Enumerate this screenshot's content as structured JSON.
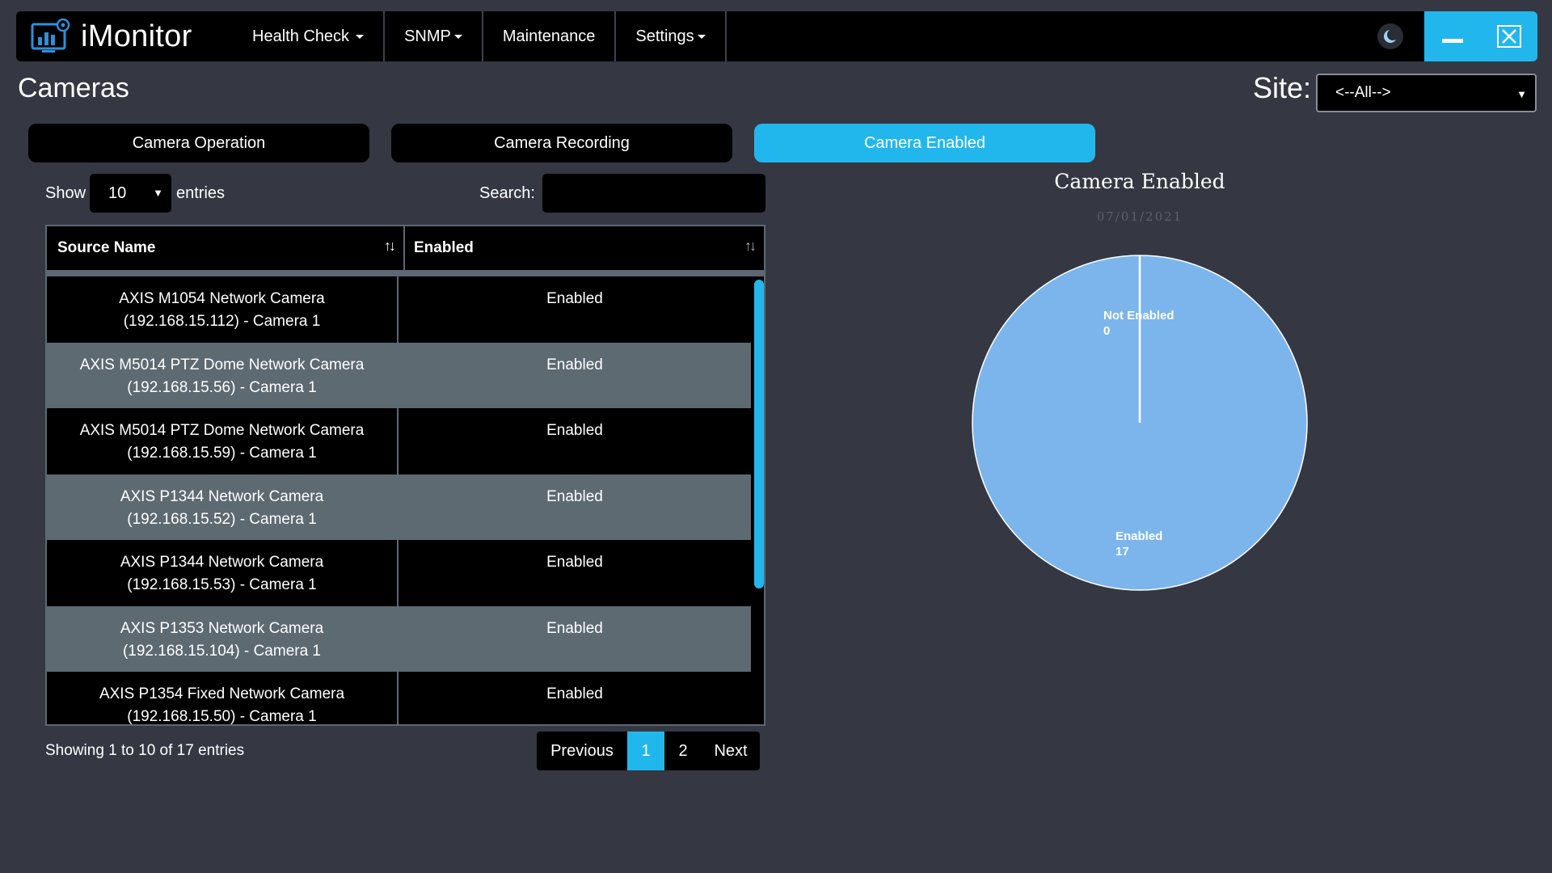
{
  "app": {
    "name": "iMonitor"
  },
  "nav": {
    "items": [
      {
        "label": "Health Check",
        "dropdown": true
      },
      {
        "label": "SNMP",
        "dropdown": true
      },
      {
        "label": "Maintenance",
        "dropdown": false
      },
      {
        "label": "Settings",
        "dropdown": true
      }
    ]
  },
  "page": {
    "title": "Cameras"
  },
  "site": {
    "label": "Site:",
    "value": "<--All-->"
  },
  "tabs": [
    {
      "label": "Camera Operation",
      "active": false
    },
    {
      "label": "Camera Recording",
      "active": false
    },
    {
      "label": "Camera Enabled",
      "active": true
    }
  ],
  "table_controls": {
    "show_label": "Show",
    "entries_value": "10",
    "entries_label": "entries",
    "search_label": "Search:",
    "search_value": ""
  },
  "table": {
    "columns": [
      "Source Name",
      "Enabled"
    ],
    "rows": [
      {
        "name_line1": "AXIS M1054 Network Camera",
        "name_line2": "(192.168.15.112) - Camera 1",
        "enabled": "Enabled"
      },
      {
        "name_line1": "AXIS M5014 PTZ Dome Network Camera",
        "name_line2": "(192.168.15.56) - Camera 1",
        "enabled": "Enabled"
      },
      {
        "name_line1": "AXIS M5014 PTZ Dome Network Camera",
        "name_line2": "(192.168.15.59) - Camera 1",
        "enabled": "Enabled"
      },
      {
        "name_line1": "AXIS P1344 Network Camera",
        "name_line2": "(192.168.15.52) - Camera 1",
        "enabled": "Enabled"
      },
      {
        "name_line1": "AXIS P1344 Network Camera",
        "name_line2": "(192.168.15.53) - Camera 1",
        "enabled": "Enabled"
      },
      {
        "name_line1": "AXIS P1353 Network Camera",
        "name_line2": "(192.168.15.104) - Camera 1",
        "enabled": "Enabled"
      },
      {
        "name_line1": "AXIS P1354 Fixed Network Camera",
        "name_line2": "(192.168.15.50) - Camera 1",
        "enabled": "Enabled"
      }
    ]
  },
  "footer": {
    "showing": "Showing 1 to 10 of 17 entries",
    "prev": "Previous",
    "pages": [
      "1",
      "2"
    ],
    "active_page": "1",
    "next": "Next"
  },
  "colors": {
    "accent": "#22b7ec",
    "background": "#353843",
    "pie": "#7cb5ec"
  },
  "icons": [
    "monitor-logo-icon",
    "moon-icon",
    "minimize-icon",
    "close-icon",
    "sort-icon",
    "caret-down-icon"
  ],
  "chart_data": {
    "type": "pie",
    "title": "Camera Enabled",
    "subtitle": "07/01/2021",
    "slices": [
      {
        "label": "Not Enabled",
        "value": 0
      },
      {
        "label": "Enabled",
        "value": 17
      }
    ]
  }
}
